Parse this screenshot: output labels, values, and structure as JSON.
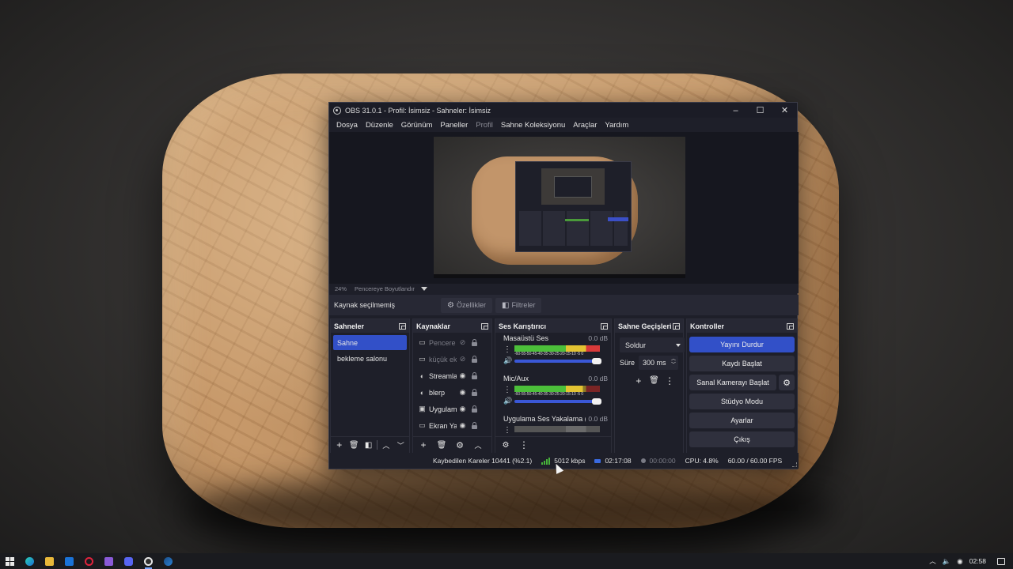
{
  "window": {
    "title": "OBS 31.0.1 - Profil: İsimsiz - Sahneler: İsimsiz",
    "minimize": "–",
    "maximize": "☐",
    "close": "✕"
  },
  "menu": [
    "Dosya",
    "Düzenle",
    "Görünüm",
    "Paneller",
    "Profil",
    "Sahne Koleksiyonu",
    "Araçlar",
    "Yardım"
  ],
  "preview": {
    "zoom": "24%",
    "scale_mode": "Pencereye Boyutlandır"
  },
  "source_toolbar": {
    "status": "Kaynak seçilmemiş",
    "properties": "Özellikler",
    "filters": "Filtreler"
  },
  "scenes": {
    "title": "Sahneler",
    "items": [
      {
        "label": "Sahne",
        "active": true
      },
      {
        "label": "bekleme salonu",
        "active": false
      }
    ]
  },
  "sources": {
    "title": "Kaynaklar",
    "items": [
      {
        "label": "Pencere",
        "icon": "window-capture-icon",
        "visible": false
      },
      {
        "label": "küçük ek",
        "icon": "window-capture-icon",
        "visible": false
      },
      {
        "label": "Streamla",
        "icon": "browser-source-icon",
        "visible": true
      },
      {
        "label": "blerp",
        "icon": "browser-source-icon",
        "visible": true
      },
      {
        "label": "Uygulam",
        "icon": "audio-capture-icon",
        "visible": true
      },
      {
        "label": "Ekran Ya",
        "icon": "display-capture-icon",
        "visible": true
      }
    ]
  },
  "mixer": {
    "title": "Ses Karıştırıcı",
    "tracks": [
      {
        "name": "Masaüstü Ses",
        "db": "0.0 dB",
        "volume": 1.0,
        "active": true
      },
      {
        "name": "Mic/Aux",
        "db": "0.0 dB",
        "volume": 1.0,
        "active": true
      },
      {
        "name": "Uygulama Ses Yakalama (B",
        "db": "0.0 dB",
        "volume": 1.0,
        "active": false
      }
    ],
    "scale": "-60-55-50-45-40-35-30-25-20-15-10 -5  0"
  },
  "transitions": {
    "title": "Sahne Geçişleri",
    "selected": "Soldur",
    "duration_label": "Süre",
    "duration_value": "300 ms"
  },
  "controls": {
    "title": "Kontroller",
    "stop_stream": "Yayını Durdur",
    "start_record": "Kaydı Başlat",
    "virtual_camera": "Sanal Kamerayı Başlat",
    "studio_mode": "Stüdyo Modu",
    "settings": "Ayarlar",
    "exit": "Çıkış"
  },
  "status": {
    "dropped_frames": "Kaybedilen Kareler 10441 (%2.1)",
    "bitrate": "5012 kbps",
    "stream_time": "02:17:08",
    "record_time": "00:00:00",
    "cpu": "CPU: 4.8%",
    "fps": "60.00 / 60.00 FPS"
  },
  "taskbar": {
    "clock": "02:58",
    "apps": [
      "edge-icon",
      "file-explorer-icon",
      "outlook-icon",
      "opera-gx-icon",
      "visual-studio-icon",
      "discord-icon",
      "obs-icon",
      "steam-icon"
    ]
  },
  "colors": {
    "accent": "#3250c8",
    "panel_bg": "#1e1f29",
    "header_bg": "#272834"
  }
}
